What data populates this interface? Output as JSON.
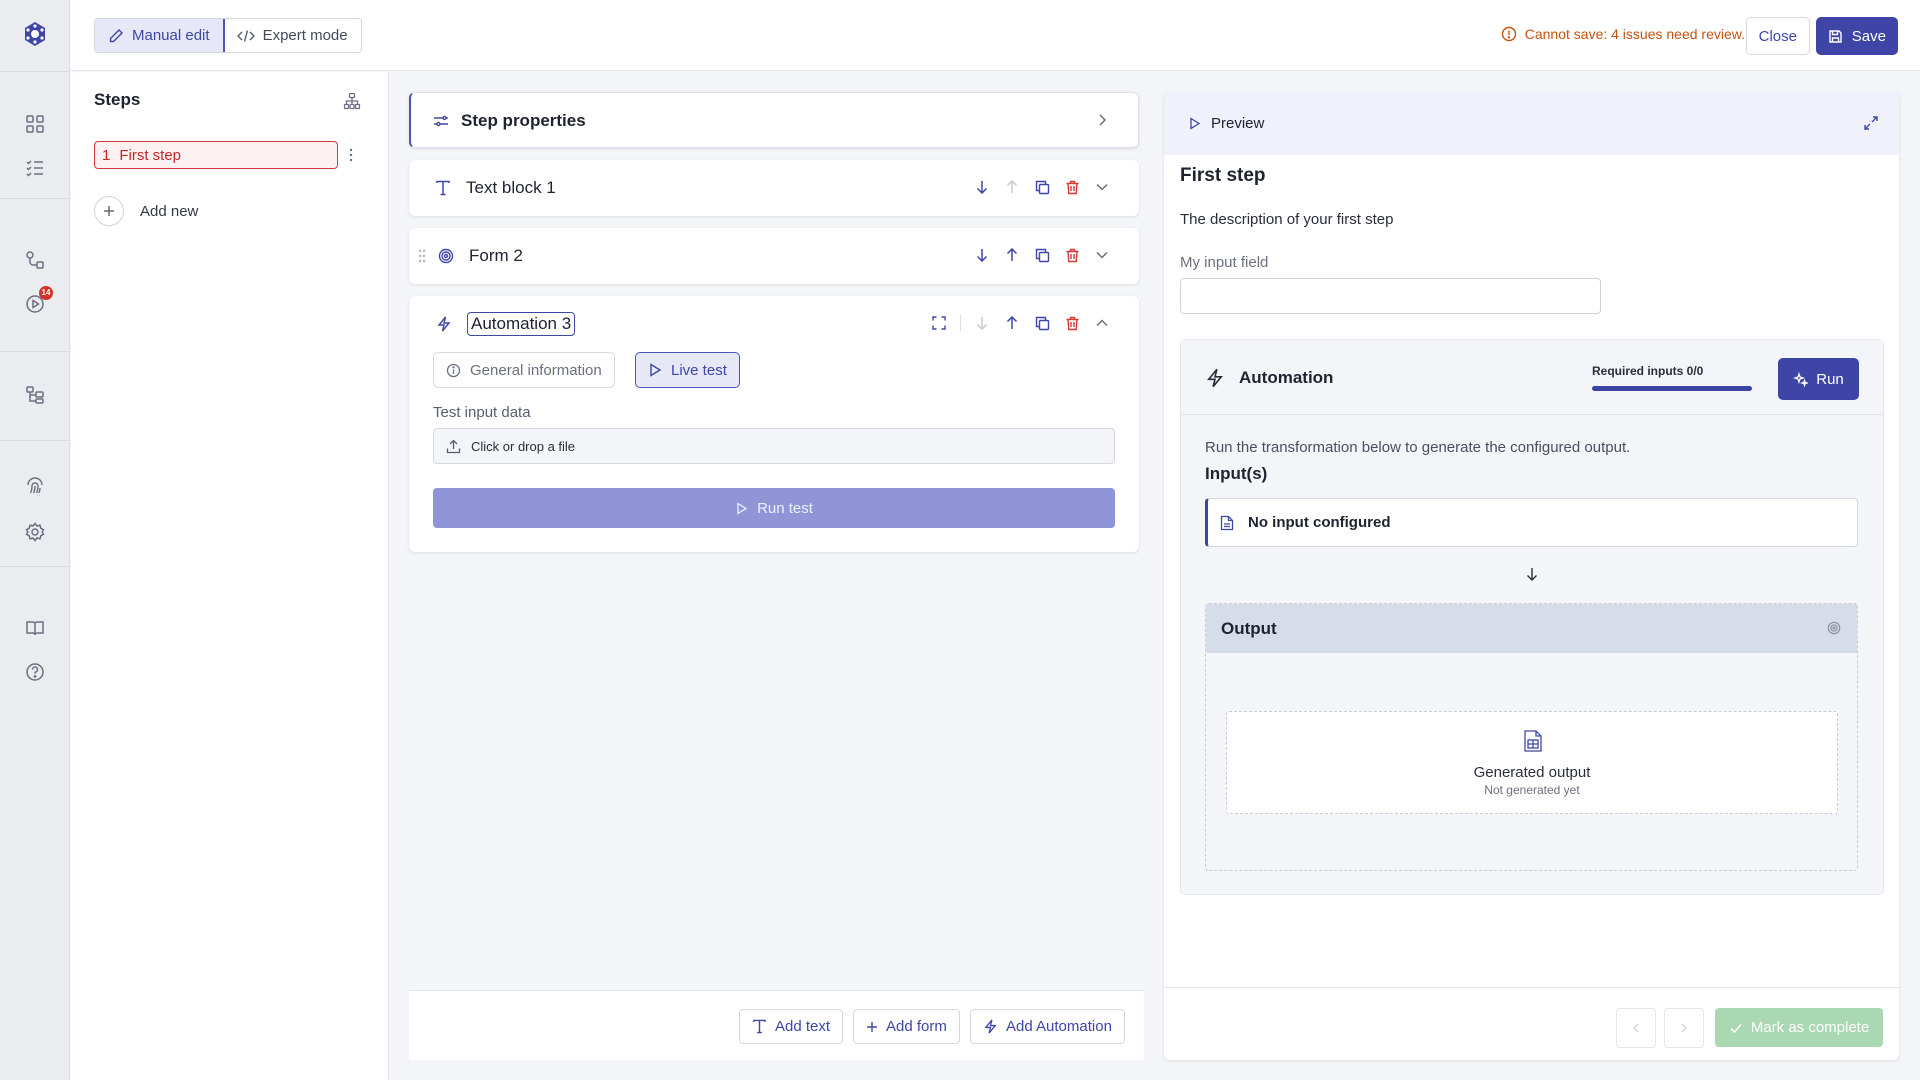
{
  "rail": {
    "badge_count": "14",
    "icons": [
      "logo-icon",
      "dashboard-icon",
      "checklist-icon",
      "workflow-icon",
      "runs-icon",
      "hierarchy-icon",
      "fingerprint-icon",
      "settings-icon",
      "book-icon",
      "help-icon"
    ]
  },
  "topbar": {
    "manual_edit": "Manual edit",
    "expert_mode": "Expert mode",
    "warning": "Cannot save: 4 issues need review.",
    "close": "Close",
    "save": "Save"
  },
  "steps": {
    "title": "Steps",
    "items": [
      {
        "number": "1",
        "label": "First step"
      }
    ],
    "add_new": "Add new"
  },
  "editor": {
    "step_properties": "Step properties",
    "blocks": [
      {
        "title": "Text block 1"
      },
      {
        "title": "Form 2"
      },
      {
        "title": "Automation 3"
      }
    ],
    "tabs": {
      "general": "General information",
      "live": "Live test"
    },
    "test_input_label": "Test input data",
    "file_drop": "Click or drop a file",
    "run_test": "Run test",
    "add_text": "Add text",
    "add_form": "Add form",
    "add_automation": "Add Automation"
  },
  "preview": {
    "header": "Preview",
    "step_title": "First step",
    "description": "The description of your first step",
    "input_label": "My input field",
    "input_value": "",
    "automation": {
      "title": "Automation",
      "required_inputs": "Required inputs 0/0",
      "progress": 1.0,
      "run": "Run",
      "description": "Run the transformation below to generate the configured output.",
      "inputs_label": "Input(s)",
      "no_input": "No input configured",
      "output_label": "Output",
      "generated_title": "Generated output",
      "generated_status": "Not generated yet"
    },
    "mark_complete": "Mark as complete"
  },
  "colors": {
    "accent": "#3d45a6",
    "danger": "#d23a3a",
    "warning": "#c4520f",
    "success_disabled": "#a9d8b3"
  }
}
